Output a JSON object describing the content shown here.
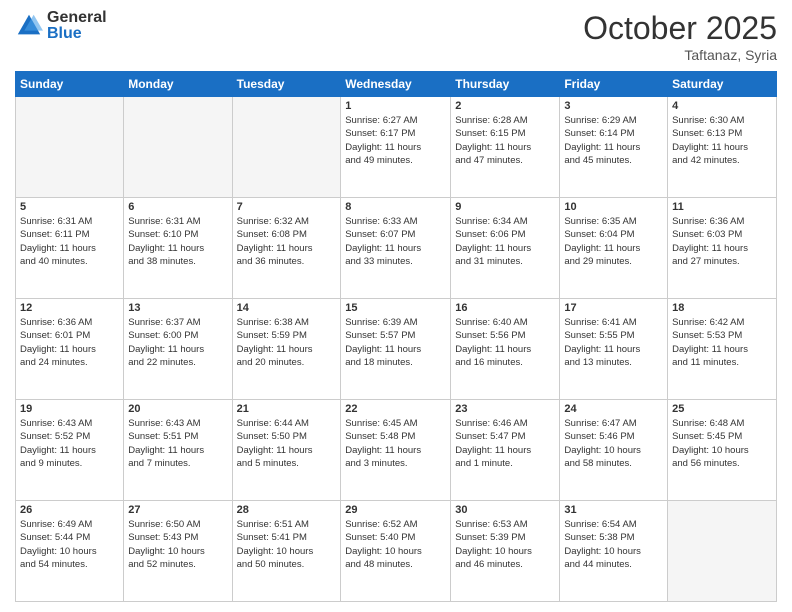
{
  "header": {
    "logo": {
      "general": "General",
      "blue": "Blue"
    },
    "title": "October 2025",
    "location": "Taftanaz, Syria"
  },
  "calendar": {
    "days_of_week": [
      "Sunday",
      "Monday",
      "Tuesday",
      "Wednesday",
      "Thursday",
      "Friday",
      "Saturday"
    ],
    "weeks": [
      [
        {
          "day": "",
          "info": ""
        },
        {
          "day": "",
          "info": ""
        },
        {
          "day": "",
          "info": ""
        },
        {
          "day": "1",
          "info": "Sunrise: 6:27 AM\nSunset: 6:17 PM\nDaylight: 11 hours\nand 49 minutes."
        },
        {
          "day": "2",
          "info": "Sunrise: 6:28 AM\nSunset: 6:15 PM\nDaylight: 11 hours\nand 47 minutes."
        },
        {
          "day": "3",
          "info": "Sunrise: 6:29 AM\nSunset: 6:14 PM\nDaylight: 11 hours\nand 45 minutes."
        },
        {
          "day": "4",
          "info": "Sunrise: 6:30 AM\nSunset: 6:13 PM\nDaylight: 11 hours\nand 42 minutes."
        }
      ],
      [
        {
          "day": "5",
          "info": "Sunrise: 6:31 AM\nSunset: 6:11 PM\nDaylight: 11 hours\nand 40 minutes."
        },
        {
          "day": "6",
          "info": "Sunrise: 6:31 AM\nSunset: 6:10 PM\nDaylight: 11 hours\nand 38 minutes."
        },
        {
          "day": "7",
          "info": "Sunrise: 6:32 AM\nSunset: 6:08 PM\nDaylight: 11 hours\nand 36 minutes."
        },
        {
          "day": "8",
          "info": "Sunrise: 6:33 AM\nSunset: 6:07 PM\nDaylight: 11 hours\nand 33 minutes."
        },
        {
          "day": "9",
          "info": "Sunrise: 6:34 AM\nSunset: 6:06 PM\nDaylight: 11 hours\nand 31 minutes."
        },
        {
          "day": "10",
          "info": "Sunrise: 6:35 AM\nSunset: 6:04 PM\nDaylight: 11 hours\nand 29 minutes."
        },
        {
          "day": "11",
          "info": "Sunrise: 6:36 AM\nSunset: 6:03 PM\nDaylight: 11 hours\nand 27 minutes."
        }
      ],
      [
        {
          "day": "12",
          "info": "Sunrise: 6:36 AM\nSunset: 6:01 PM\nDaylight: 11 hours\nand 24 minutes."
        },
        {
          "day": "13",
          "info": "Sunrise: 6:37 AM\nSunset: 6:00 PM\nDaylight: 11 hours\nand 22 minutes."
        },
        {
          "day": "14",
          "info": "Sunrise: 6:38 AM\nSunset: 5:59 PM\nDaylight: 11 hours\nand 20 minutes."
        },
        {
          "day": "15",
          "info": "Sunrise: 6:39 AM\nSunset: 5:57 PM\nDaylight: 11 hours\nand 18 minutes."
        },
        {
          "day": "16",
          "info": "Sunrise: 6:40 AM\nSunset: 5:56 PM\nDaylight: 11 hours\nand 16 minutes."
        },
        {
          "day": "17",
          "info": "Sunrise: 6:41 AM\nSunset: 5:55 PM\nDaylight: 11 hours\nand 13 minutes."
        },
        {
          "day": "18",
          "info": "Sunrise: 6:42 AM\nSunset: 5:53 PM\nDaylight: 11 hours\nand 11 minutes."
        }
      ],
      [
        {
          "day": "19",
          "info": "Sunrise: 6:43 AM\nSunset: 5:52 PM\nDaylight: 11 hours\nand 9 minutes."
        },
        {
          "day": "20",
          "info": "Sunrise: 6:43 AM\nSunset: 5:51 PM\nDaylight: 11 hours\nand 7 minutes."
        },
        {
          "day": "21",
          "info": "Sunrise: 6:44 AM\nSunset: 5:50 PM\nDaylight: 11 hours\nand 5 minutes."
        },
        {
          "day": "22",
          "info": "Sunrise: 6:45 AM\nSunset: 5:48 PM\nDaylight: 11 hours\nand 3 minutes."
        },
        {
          "day": "23",
          "info": "Sunrise: 6:46 AM\nSunset: 5:47 PM\nDaylight: 11 hours\nand 1 minute."
        },
        {
          "day": "24",
          "info": "Sunrise: 6:47 AM\nSunset: 5:46 PM\nDaylight: 10 hours\nand 58 minutes."
        },
        {
          "day": "25",
          "info": "Sunrise: 6:48 AM\nSunset: 5:45 PM\nDaylight: 10 hours\nand 56 minutes."
        }
      ],
      [
        {
          "day": "26",
          "info": "Sunrise: 6:49 AM\nSunset: 5:44 PM\nDaylight: 10 hours\nand 54 minutes."
        },
        {
          "day": "27",
          "info": "Sunrise: 6:50 AM\nSunset: 5:43 PM\nDaylight: 10 hours\nand 52 minutes."
        },
        {
          "day": "28",
          "info": "Sunrise: 6:51 AM\nSunset: 5:41 PM\nDaylight: 10 hours\nand 50 minutes."
        },
        {
          "day": "29",
          "info": "Sunrise: 6:52 AM\nSunset: 5:40 PM\nDaylight: 10 hours\nand 48 minutes."
        },
        {
          "day": "30",
          "info": "Sunrise: 6:53 AM\nSunset: 5:39 PM\nDaylight: 10 hours\nand 46 minutes."
        },
        {
          "day": "31",
          "info": "Sunrise: 6:54 AM\nSunset: 5:38 PM\nDaylight: 10 hours\nand 44 minutes."
        },
        {
          "day": "",
          "info": ""
        }
      ]
    ]
  }
}
